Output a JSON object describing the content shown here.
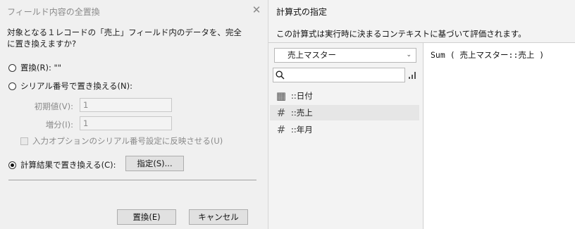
{
  "left_dialog": {
    "title": "フィールド内容の全置換",
    "close_glyph": "✕",
    "description": "対象となる１レコードの「売上」フィールド内のデータを、完全に置き換えますか?",
    "option_replace": "置換(R): \"\"",
    "option_serial": "シリアル番号で置き換える(N):",
    "initial_label": "初期値(V):",
    "initial_value": "1",
    "increment_label": "増分(I):",
    "increment_value": "1",
    "update_option": "入力オプションのシリアル番号設定に反映させる(U)",
    "option_calc": "計算結果で置き換える(C):",
    "specify_button": "指定(S)...",
    "replace_button": "置換(E)",
    "cancel_button": "キャンセル",
    "selected_option": "calc"
  },
  "right_dialog": {
    "title": "計算式の指定",
    "description": "この計算式は実行時に決まるコンテキストに基づいて評価されます。",
    "table_select": "売上マスター",
    "search_placeholder": "",
    "fields": [
      {
        "name": "::日付",
        "icon": "calendar-icon",
        "glyph": "▦"
      },
      {
        "name": "::売上",
        "icon": "number-icon",
        "glyph": "#"
      },
      {
        "name": "::年月",
        "icon": "number-icon",
        "glyph": "#"
      }
    ],
    "selected_field_index": 1,
    "formula": "Sum ( 売上マスター::売上 )"
  }
}
